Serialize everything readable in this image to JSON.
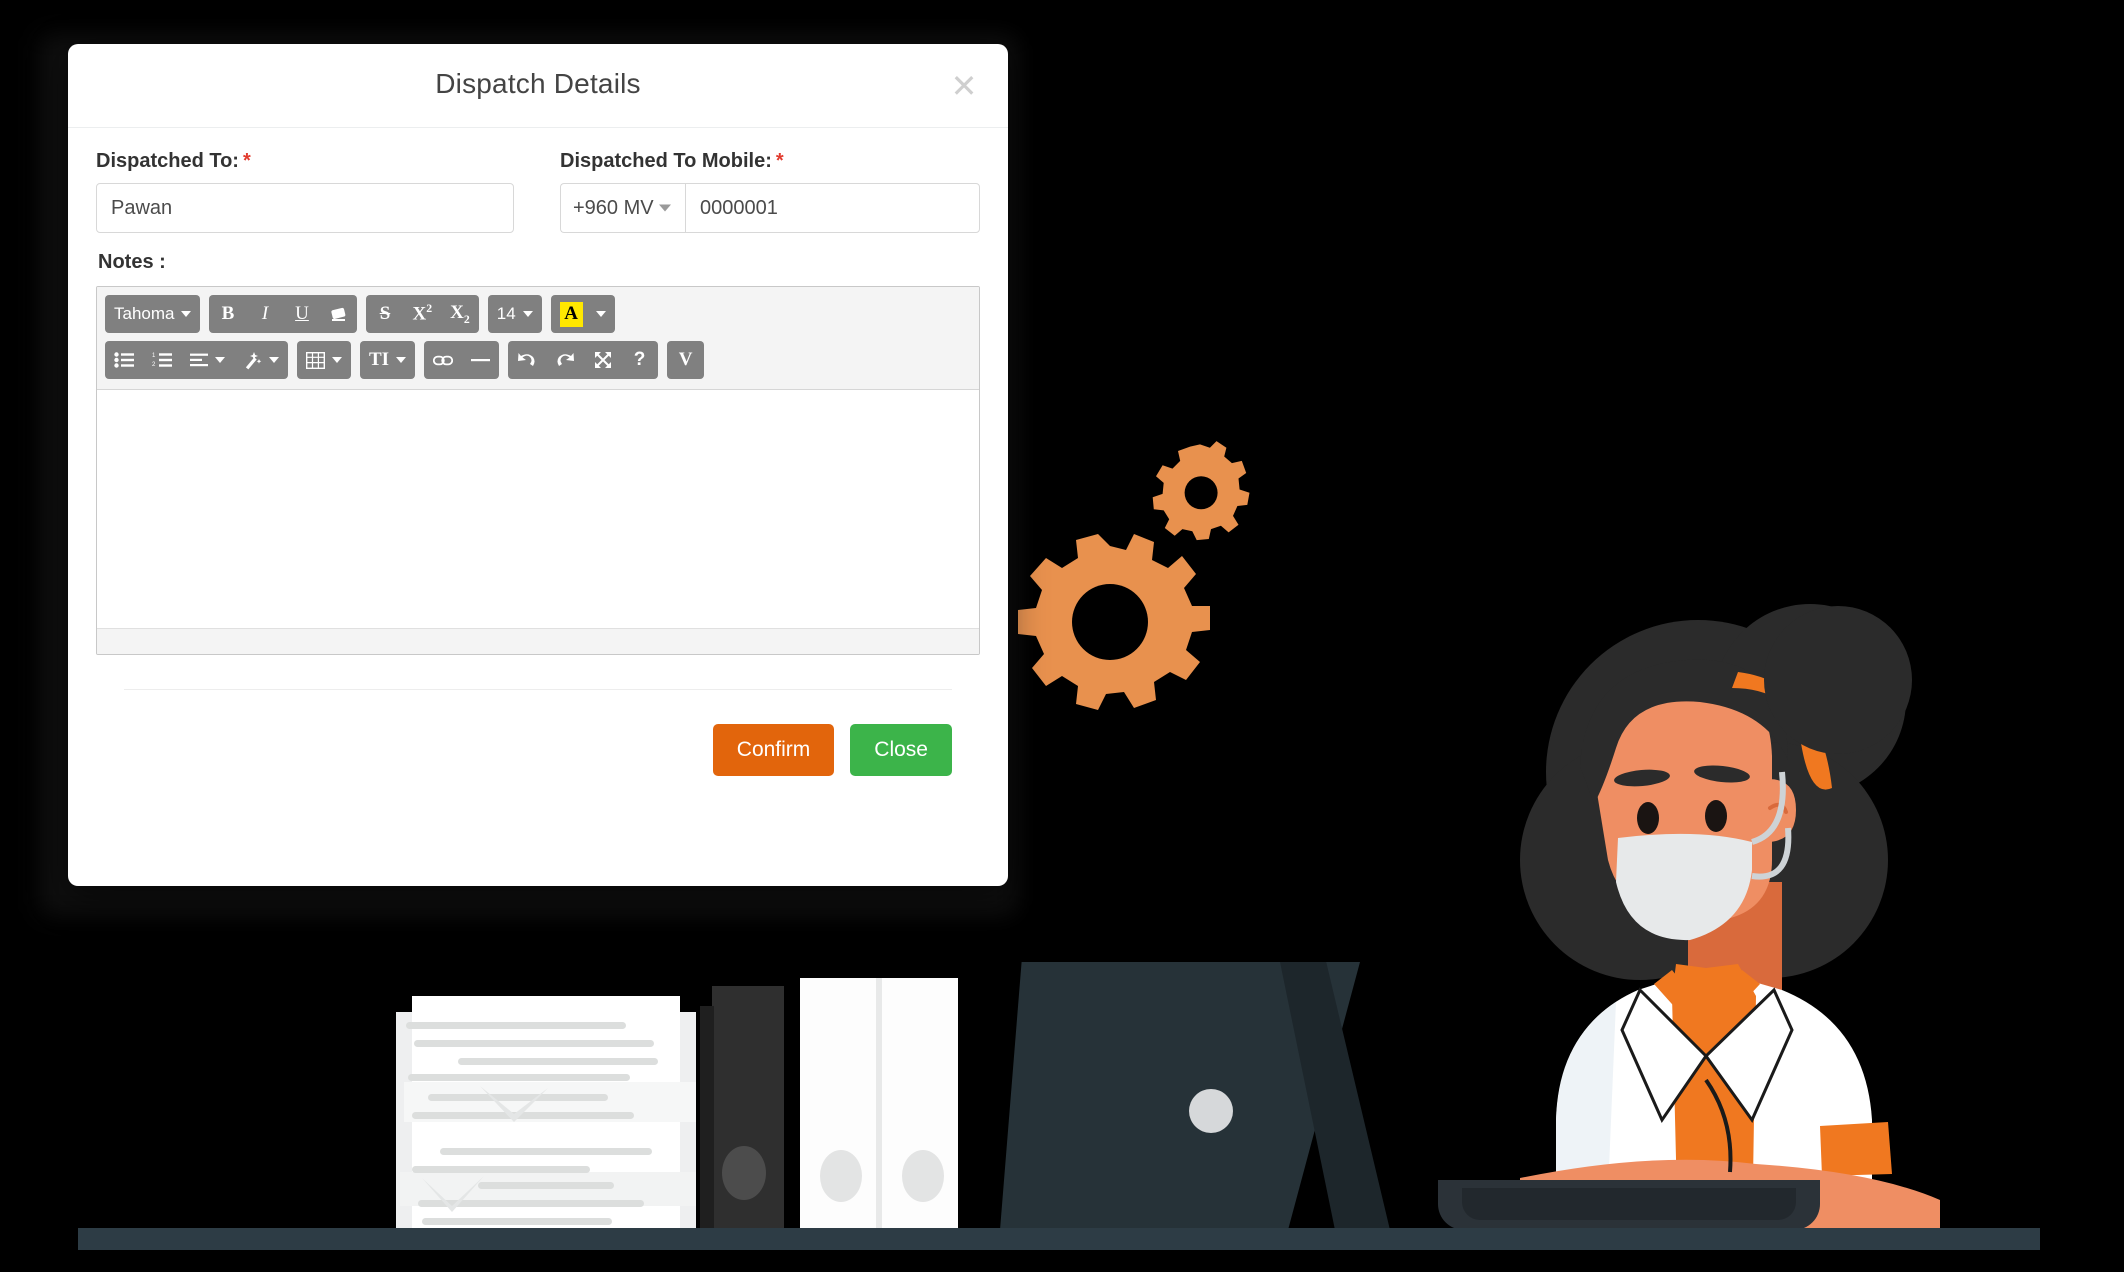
{
  "modal": {
    "title": "Dispatch Details",
    "close_icon": "close-x-icon",
    "fields": {
      "dispatched_to": {
        "label": "Dispatched To:",
        "required_marker": "*",
        "value": "Pawan",
        "placeholder": ""
      },
      "dispatched_to_mobile": {
        "label": "Dispatched To Mobile:",
        "required_marker": "*",
        "country_code": "+960 MV",
        "value": "0000001",
        "placeholder": ""
      },
      "notes": {
        "label": "Notes  :",
        "content": ""
      }
    },
    "footer": {
      "confirm_label": "Confirm",
      "close_label": "Close"
    }
  },
  "editor": {
    "toolbar_rows": [
      [
        {
          "group": [
            {
              "name": "font-family-dropdown",
              "label": "Tahoma",
              "caret": true
            }
          ]
        },
        {
          "group": [
            {
              "name": "bold-button",
              "label": "B"
            },
            {
              "name": "italic-button",
              "label": "I"
            },
            {
              "name": "underline-button",
              "label": "U"
            },
            {
              "name": "remove-format-button",
              "label": ""
            }
          ]
        },
        {
          "group": [
            {
              "name": "strikethrough-button",
              "label": "S"
            },
            {
              "name": "superscript-button",
              "label": "X"
            },
            {
              "name": "subscript-button",
              "label": "X"
            }
          ]
        },
        {
          "group": [
            {
              "name": "font-size-dropdown",
              "label": "14",
              "caret": true
            }
          ]
        },
        {
          "group": [
            {
              "name": "highlight-color-dropdown",
              "label": "A",
              "caret": true
            }
          ]
        }
      ],
      [
        {
          "group": [
            {
              "name": "unordered-list-button",
              "label": ""
            },
            {
              "name": "ordered-list-button",
              "label": ""
            },
            {
              "name": "align-dropdown",
              "label": "",
              "caret": true
            },
            {
              "name": "styles-magic-wand-dropdown",
              "label": "",
              "caret": true
            }
          ]
        },
        {
          "group": [
            {
              "name": "table-dropdown",
              "label": "",
              "caret": true
            }
          ]
        },
        {
          "group": [
            {
              "name": "paragraph-format-dropdown",
              "label": "TI",
              "caret": true
            }
          ]
        },
        {
          "group": [
            {
              "name": "insert-link-button",
              "label": ""
            },
            {
              "name": "horizontal-rule-button",
              "label": ""
            }
          ]
        },
        {
          "group": [
            {
              "name": "undo-button",
              "label": ""
            },
            {
              "name": "redo-button",
              "label": ""
            },
            {
              "name": "fullscreen-button",
              "label": ""
            },
            {
              "name": "help-button",
              "label": "?"
            }
          ]
        },
        {
          "group": [
            {
              "name": "code-view-button",
              "label": "V"
            }
          ]
        }
      ]
    ],
    "font_family_value": "Tahoma",
    "font_size_value": "14",
    "highlight_letter": "A",
    "paragraph_format_label": "TI",
    "help_label": "?",
    "code_view_label": "V"
  },
  "colors": {
    "confirm_orange": "#e2650c",
    "close_green": "#3cb44a",
    "required_red": "#e23b2e",
    "toolbar_gray": "#808080",
    "highlight_yellow": "#ffe800",
    "gear_orange": "#e8914e",
    "accent_orange": "#f07820",
    "laptop_dark": "#263238",
    "desk_dark": "#2d3c45",
    "background": "#000000"
  },
  "illustration": {
    "scene_name": "office-worker-with-mask-at-laptop",
    "gears": [
      "large-gear",
      "small-gear"
    ],
    "objects": [
      "paper-stack",
      "dark-binder",
      "white-binders",
      "laptop",
      "desk"
    ],
    "character": {
      "name": "female-office-worker",
      "hair": "afro-bun",
      "headband": "orange",
      "mask": "white-face-mask",
      "coat": "white-lab-coat",
      "shirt": "orange-shirt"
    }
  }
}
